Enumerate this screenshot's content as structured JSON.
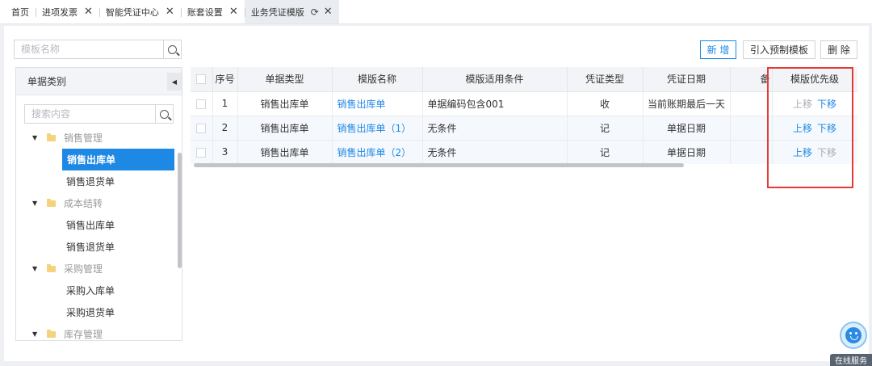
{
  "tabs": [
    {
      "label": "首页",
      "closable": false
    },
    {
      "label": "进项发票",
      "closable": true
    },
    {
      "label": "智能凭证中心",
      "closable": true
    },
    {
      "label": "账套设置",
      "closable": true
    },
    {
      "label": "业务凭证模版",
      "closable": true,
      "active": true
    }
  ],
  "search": {
    "placeholder": "模板名称"
  },
  "sidebar": {
    "title": "单据类别",
    "search_placeholder": "搜索内容",
    "groups": [
      {
        "label": "销售管理",
        "items": [
          "销售出库单",
          "销售退货单"
        ]
      },
      {
        "label": "成本结转",
        "items": [
          "销售出库单",
          "销售退货单"
        ]
      },
      {
        "label": "采购管理",
        "items": [
          "采购入库单",
          "采购退货单"
        ]
      },
      {
        "label": "库存管理",
        "items": []
      }
    ],
    "selected": "销售出库单"
  },
  "toolbar": {
    "add": "新 增",
    "import": "引入预制模板",
    "delete": "删 除"
  },
  "table": {
    "columns": [
      "序号",
      "单据类型",
      "模版名称",
      "模版适用条件",
      "凭证类型",
      "凭证日期",
      "备",
      "模版优先级"
    ],
    "rows": [
      {
        "no": "1",
        "doc_type": "销售出库单",
        "template": "销售出库单",
        "condition": "单据编码包含001",
        "voucher_type": "收",
        "date": "当前账期最后一天",
        "up": "上移",
        "down": "下移",
        "up_enabled": false,
        "down_enabled": true
      },
      {
        "no": "2",
        "doc_type": "销售出库单",
        "template": "销售出库单（1）",
        "condition": "无条件",
        "voucher_type": "记",
        "date": "单据日期",
        "up": "上移",
        "down": "下移",
        "up_enabled": true,
        "down_enabled": true
      },
      {
        "no": "3",
        "doc_type": "销售出库单",
        "template": "销售出库单（2）",
        "condition": "无条件",
        "voucher_type": "记",
        "date": "单据日期",
        "up": "上移",
        "down": "下移",
        "up_enabled": true,
        "down_enabled": false
      }
    ]
  },
  "service": {
    "label": "在线服务"
  },
  "colors": {
    "accent": "#1e88e5",
    "highlight": "#e53935",
    "disabled": "#a8acb2"
  }
}
